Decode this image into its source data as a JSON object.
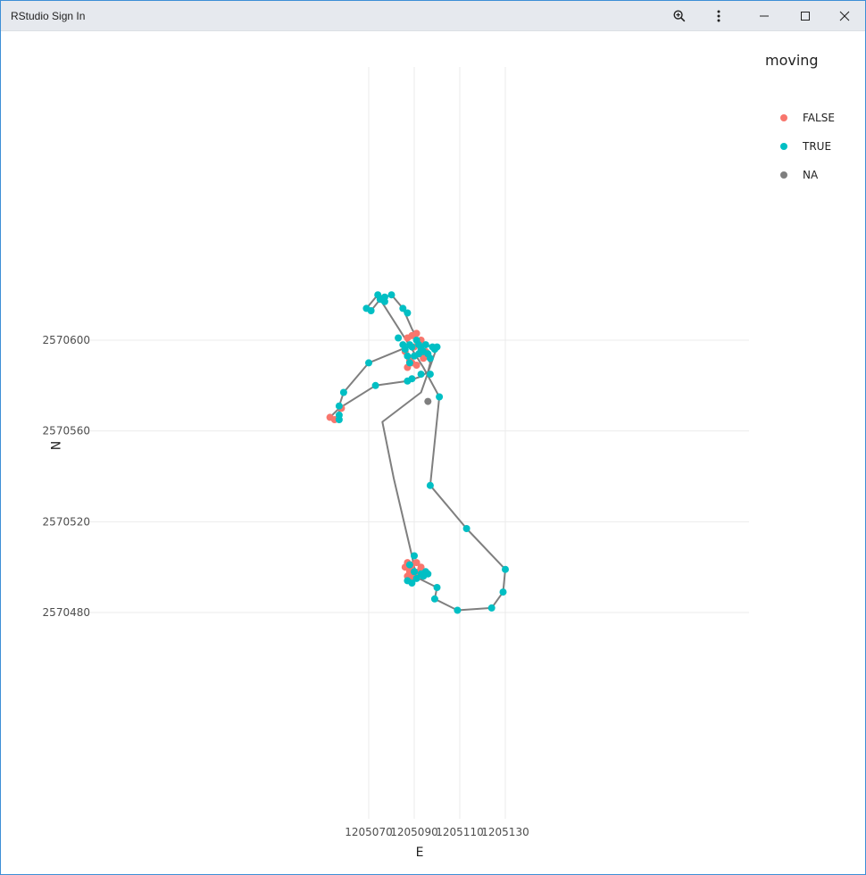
{
  "window": {
    "title": "RStudio Sign In",
    "controls": {
      "zoom": "zoom-in-icon",
      "menu": "more-vertical-icon",
      "minimize": "minimize-icon",
      "maximize": "maximize-icon",
      "close": "close-icon"
    }
  },
  "chart_data": {
    "type": "scatter",
    "title": "",
    "xlabel": "E",
    "ylabel": "N",
    "xlim": [
      1205050,
      1205200
    ],
    "ylim": [
      2570405,
      2570635
    ],
    "x_ticks": [
      1205070,
      1205090,
      1205110,
      1205130
    ],
    "x_tick_labels": [
      "1205070",
      "1205090",
      "1205110",
      "1205130"
    ],
    "y_ticks": [
      2570480,
      2570520,
      2570560,
      2570600
    ],
    "y_tick_labels": [
      "2570480",
      "2570520",
      "2570560",
      "2570600"
    ],
    "grid": true,
    "legend": {
      "title": "moving",
      "placement": "right",
      "entries": [
        {
          "label": "FALSE",
          "color": "#f8766d"
        },
        {
          "label": "TRUE",
          "color": "#00bfc4"
        },
        {
          "label": "NA",
          "color": "#7f7f7f"
        }
      ]
    },
    "path_color": "#7f7f7f",
    "path": [
      [
        1205090,
        2570500
      ],
      [
        1205089,
        2570505
      ],
      [
        1205081,
        2570539
      ],
      [
        1205076,
        2570564
      ],
      [
        1205093,
        2570577
      ],
      [
        1205100,
        2570597
      ],
      [
        1205092,
        2570598
      ],
      [
        1205087,
        2570597
      ],
      [
        1205070,
        2570590
      ],
      [
        1205059,
        2570577
      ],
      [
        1205057,
        2570571
      ],
      [
        1205057,
        2570567
      ],
      [
        1205056,
        2570565
      ],
      [
        1205053,
        2570566
      ],
      [
        1205057,
        2570570
      ],
      [
        1205073,
        2570580
      ],
      [
        1205087,
        2570582
      ],
      [
        1205093,
        2570584
      ],
      [
        1205096,
        2570586
      ],
      [
        1205097,
        2570590
      ],
      [
        1205089,
        2570605
      ],
      [
        1205085,
        2570614
      ],
      [
        1205080,
        2570620
      ],
      [
        1205077,
        2570619
      ],
      [
        1205074,
        2570620
      ],
      [
        1205069,
        2570614
      ],
      [
        1205071,
        2570613
      ],
      [
        1205075,
        2570618
      ],
      [
        1205089,
        2570596
      ],
      [
        1205094,
        2570588
      ],
      [
        1205101,
        2570575
      ],
      [
        1205097,
        2570536
      ],
      [
        1205113,
        2570517
      ],
      [
        1205130,
        2570499
      ],
      [
        1205129,
        2570489
      ],
      [
        1205124,
        2570482
      ],
      [
        1205109,
        2570481
      ],
      [
        1205099,
        2570486
      ],
      [
        1205100,
        2570491
      ],
      [
        1205092,
        2570495
      ],
      [
        1205090,
        2570500
      ]
    ],
    "series": [
      {
        "name": "FALSE",
        "color": "#f8766d",
        "points": [
          [
            1205087,
            2570601
          ],
          [
            1205089,
            2570602
          ],
          [
            1205091,
            2570603
          ],
          [
            1205093,
            2570600
          ],
          [
            1205090,
            2570597
          ],
          [
            1205092,
            2570594
          ],
          [
            1205094,
            2570592
          ],
          [
            1205088,
            2570591
          ],
          [
            1205087,
            2570588
          ],
          [
            1205089,
            2570590
          ],
          [
            1205091,
            2570589
          ],
          [
            1205095,
            2570595
          ],
          [
            1205096,
            2570593
          ],
          [
            1205086,
            2570595
          ],
          [
            1205053,
            2570566
          ],
          [
            1205055,
            2570565
          ],
          [
            1205058,
            2570570
          ],
          [
            1205087,
            2570502
          ],
          [
            1205089,
            2570501
          ],
          [
            1205091,
            2570502
          ],
          [
            1205093,
            2570500
          ],
          [
            1205088,
            2570499
          ],
          [
            1205090,
            2570497
          ],
          [
            1205092,
            2570498
          ],
          [
            1205094,
            2570496
          ],
          [
            1205087,
            2570496
          ],
          [
            1205089,
            2570495
          ],
          [
            1205091,
            2570496
          ],
          [
            1205088,
            2570498
          ],
          [
            1205086,
            2570500
          ]
        ]
      },
      {
        "name": "TRUE",
        "color": "#00bfc4",
        "points": [
          [
            1205069,
            2570614
          ],
          [
            1205071,
            2570613
          ],
          [
            1205074,
            2570620
          ],
          [
            1205075,
            2570618
          ],
          [
            1205077,
            2570619
          ],
          [
            1205080,
            2570620
          ],
          [
            1205077,
            2570617
          ],
          [
            1205085,
            2570614
          ],
          [
            1205087,
            2570612
          ],
          [
            1205083,
            2570601
          ],
          [
            1205085,
            2570598
          ],
          [
            1205086,
            2570596
          ],
          [
            1205087,
            2570593
          ],
          [
            1205088,
            2570590
          ],
          [
            1205089,
            2570597
          ],
          [
            1205090,
            2570593
          ],
          [
            1205091,
            2570600
          ],
          [
            1205092,
            2570598
          ],
          [
            1205093,
            2570596
          ],
          [
            1205094,
            2570595
          ],
          [
            1205095,
            2570598
          ],
          [
            1205096,
            2570594
          ],
          [
            1205097,
            2570592
          ],
          [
            1205098,
            2570597
          ],
          [
            1205099,
            2570596
          ],
          [
            1205100,
            2570597
          ],
          [
            1205092,
            2570594
          ],
          [
            1205088,
            2570598
          ],
          [
            1205070,
            2570590
          ],
          [
            1205059,
            2570577
          ],
          [
            1205057,
            2570571
          ],
          [
            1205057,
            2570567
          ],
          [
            1205057,
            2570565
          ],
          [
            1205073,
            2570580
          ],
          [
            1205087,
            2570582
          ],
          [
            1205089,
            2570583
          ],
          [
            1205093,
            2570585
          ],
          [
            1205097,
            2570585
          ],
          [
            1205101,
            2570575
          ],
          [
            1205097,
            2570536
          ],
          [
            1205113,
            2570517
          ],
          [
            1205130,
            2570499
          ],
          [
            1205129,
            2570489
          ],
          [
            1205124,
            2570482
          ],
          [
            1205109,
            2570481
          ],
          [
            1205099,
            2570486
          ],
          [
            1205100,
            2570491
          ],
          [
            1205090,
            2570505
          ],
          [
            1205088,
            2570501
          ],
          [
            1205090,
            2570498
          ],
          [
            1205093,
            2570497
          ],
          [
            1205095,
            2570498
          ],
          [
            1205096,
            2570497
          ],
          [
            1205087,
            2570494
          ],
          [
            1205089,
            2570493
          ],
          [
            1205091,
            2570495
          ],
          [
            1205094,
            2570496
          ]
        ]
      },
      {
        "name": "NA",
        "color": "#7f7f7f",
        "points": [
          [
            1205096,
            2570573
          ]
        ]
      }
    ]
  }
}
